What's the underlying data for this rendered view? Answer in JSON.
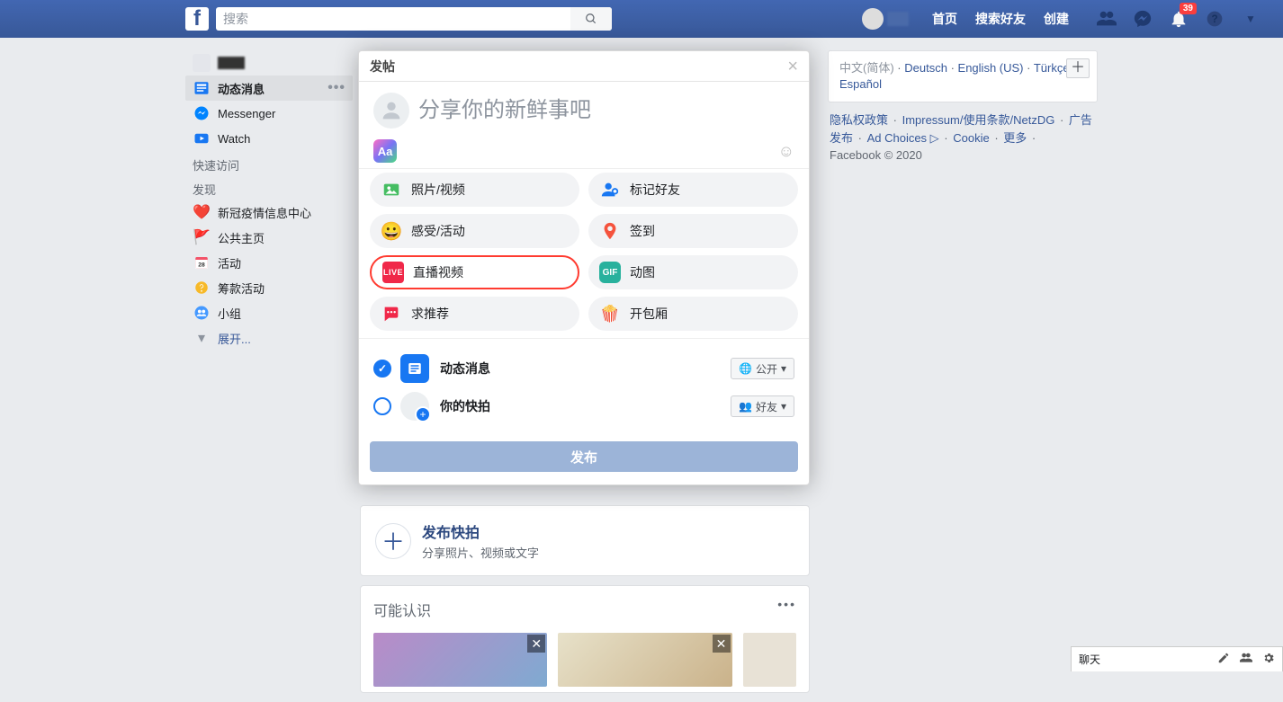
{
  "topbar": {
    "search_placeholder": "搜索",
    "nav": {
      "home": "首页",
      "find_friends": "搜索好友",
      "create": "创建"
    },
    "notif_count": "39"
  },
  "leftnav": {
    "feed": "动态消息",
    "messenger": "Messenger",
    "watch": "Watch",
    "quick": "快速访问",
    "discover": "发现",
    "covid": "新冠疫情信息中心",
    "pages": "公共主页",
    "events": "活动",
    "fundraisers": "筹款活动",
    "groups": "小组",
    "more": "展开..."
  },
  "feed": {
    "story_title": "发布快拍",
    "story_sub": "分享照片、视频或文字",
    "pymk": "可能认识"
  },
  "right": {
    "lang_current": "中文(简体)",
    "langs": [
      "Deutsch",
      "English (US)",
      "Türkçe",
      "Español"
    ],
    "legal": {
      "privacy": "隐私权政策",
      "impressum": "Impressum/使用条款/NetzDG",
      "ads": "广告发布",
      "adchoices": "Ad Choices ▷",
      "cookie": "Cookie",
      "more": "更多",
      "copyright": "Facebook © 2020"
    }
  },
  "modal": {
    "title": "发帖",
    "placeholder": "分享你的新鲜事吧",
    "aa": "Aa",
    "options": {
      "photo": "照片/视频",
      "tag": "标记好友",
      "feeling": "感受/活动",
      "checkin": "签到",
      "live": "直播视频",
      "gif": "动图",
      "gif_label": "GIF",
      "rec": "求推荐",
      "popcorn": "开包厢",
      "live_badge": "LIVE"
    },
    "dest": {
      "feed": "动态消息",
      "story": "你的快拍",
      "aud_public": "公开",
      "aud_friends": "好友"
    },
    "submit": "发布"
  },
  "chat": {
    "label": "聊天"
  }
}
